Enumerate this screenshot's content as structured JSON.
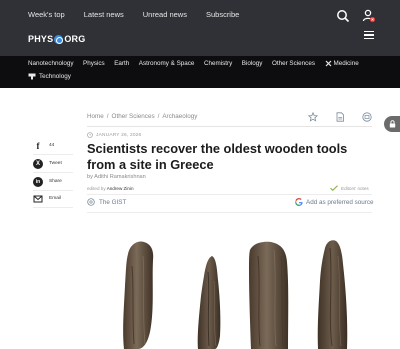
{
  "topnav": {
    "links": [
      "Week's top",
      "Latest news",
      "Unread news",
      "Subscribe"
    ]
  },
  "logo": {
    "left": "PHYS",
    "right": "ORG"
  },
  "categories": {
    "row1": [
      "Nanotechnology",
      "Physics",
      "Earth",
      "Astronomy & Space",
      "Chemistry",
      "Biology",
      "Other Sciences",
      "Medicine"
    ],
    "row2": [
      "Technology"
    ]
  },
  "breadcrumb": [
    "Home",
    "/",
    "Other Sciences",
    "/",
    "Archaeology"
  ],
  "article": {
    "date": "JANUARY 26, 2026",
    "title": "Scientists recover the oldest wooden tools from a site in Greece",
    "byline_prefix": "by",
    "author": "Adithi Ramakrishnan",
    "edited_prefix": "edited by",
    "editor": "Andrew Zinin",
    "editors_notes": "Editors' notes",
    "gist": "The GIST",
    "preferred_source": "Add as preferred source"
  },
  "share": [
    {
      "count": "44",
      "icon": "facebook-icon"
    },
    {
      "label": "Tweet",
      "icon": "x-icon"
    },
    {
      "label": "Share",
      "icon": "linkedin-icon"
    },
    {
      "label": "Email",
      "icon": "email-icon"
    }
  ],
  "colors": {
    "topbar": "#2f3136",
    "catbar": "#0d0d0f",
    "logo_dot": "#3b8de0",
    "title": "#1c1c1c"
  }
}
